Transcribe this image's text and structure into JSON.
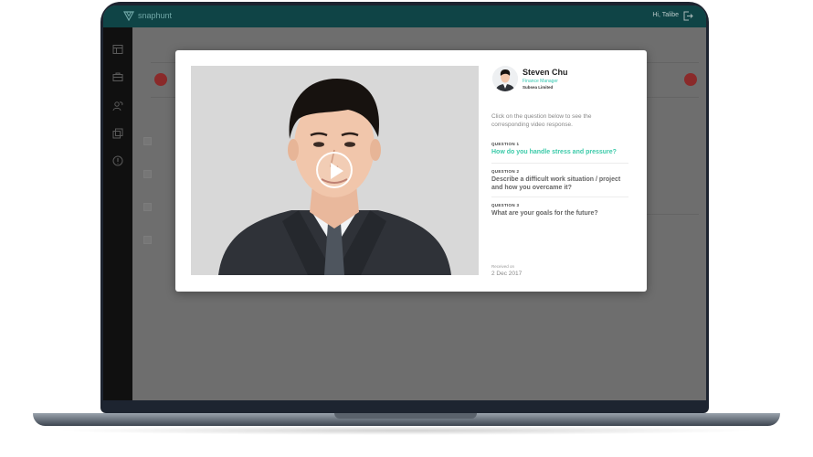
{
  "app": {
    "logo_text": "snaphunt",
    "greeting": "Hi, Talibe"
  },
  "candidate": {
    "name": "Steven Chu",
    "role": "Finance Manager",
    "company": "Subsea Limited"
  },
  "modal": {
    "instructions": "Click on the question below to see the corresponding video response.",
    "questions": [
      {
        "label": "QUESTION 1",
        "text": "How do you handle stress and pressure?",
        "active": true
      },
      {
        "label": "QUESTION 2",
        "text": "Describe a difficult work situation / project and how you overcame it?",
        "active": false
      },
      {
        "label": "QUESTION 3",
        "text": "What are your goals for the future?",
        "active": false
      }
    ],
    "received_label": "Received on",
    "received_date": "2 Dec 2017"
  },
  "colors": {
    "accent": "#3ccaa9",
    "topbar": "#0f4446",
    "sidebar": "#101010"
  },
  "icons": [
    "logout-icon",
    "play-icon",
    "table-icon",
    "briefcase-icon",
    "users-icon",
    "layers-icon",
    "info-icon"
  ]
}
